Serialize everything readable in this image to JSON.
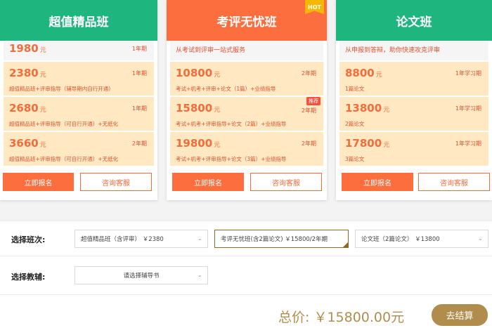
{
  "cards": [
    {
      "title": "超值精品班",
      "first": {
        "price": "1980",
        "unit": "元",
        "period": "1年期"
      },
      "options": [
        {
          "price": "2380",
          "unit": "元",
          "period": "1年期",
          "desc": "超值精品班+评审指导（辅导期内自行开通）"
        },
        {
          "price": "2680",
          "unit": "元",
          "period": "1年期",
          "desc": "超值精品班+评审指导（可自行开通）+无纸化"
        },
        {
          "price": "3660",
          "unit": "元",
          "period": "2年期",
          "desc": "超值精品班+评审指导（可自行开通）+无纸化"
        }
      ],
      "enroll": "立即报名",
      "consult": "咨询客服"
    },
    {
      "title": "考评无忧班",
      "hot": "HOT",
      "tagline": "从考试到评审一站式服务",
      "options": [
        {
          "price": "10800",
          "unit": "元",
          "period": "2年期",
          "desc": "考试+机考+评审+论文（1篇）+业绩指导"
        },
        {
          "price": "15800",
          "unit": "元",
          "period": "2年期",
          "desc": "考试+机考+评审指导+论文（2篇）+业绩指导",
          "badge": "推荐"
        },
        {
          "price": "19800",
          "unit": "元",
          "period": "2年期",
          "desc": "考试+机考+评审指导+论文（3篇）+业绩指导"
        }
      ],
      "enroll": "立即报名",
      "consult": "咨询客服"
    },
    {
      "title": "论文班",
      "tagline": "从申报到答辩，助你快速攻克评审",
      "options": [
        {
          "price": "8800",
          "unit": "元",
          "period": "1年学习期",
          "desc": "1篇论文"
        },
        {
          "price": "13800",
          "unit": "元",
          "period": "1年学习期",
          "desc": "2篇论文"
        },
        {
          "price": "17800",
          "unit": "元",
          "period": "1年学习期",
          "desc": "3篇论文"
        }
      ],
      "enroll": "立即报名",
      "consult": "咨询客服"
    }
  ],
  "selection": {
    "class_label": "选择班次:",
    "class_options": [
      "超值精品班（含评审）  ￥2380",
      "考评无忧班(含2篇论文)  ￥15800/2年期",
      "论文班（2篇论文）  ￥13800"
    ],
    "book_label": "选择教辅:",
    "book_placeholder": "请选择辅导书"
  },
  "footer": {
    "total": "总价: ￥15800.00元",
    "checkout": "去结算"
  },
  "colors": {
    "green": "#1fb57f",
    "orange": "#fd6e3f",
    "gold": "#b08d4c"
  }
}
